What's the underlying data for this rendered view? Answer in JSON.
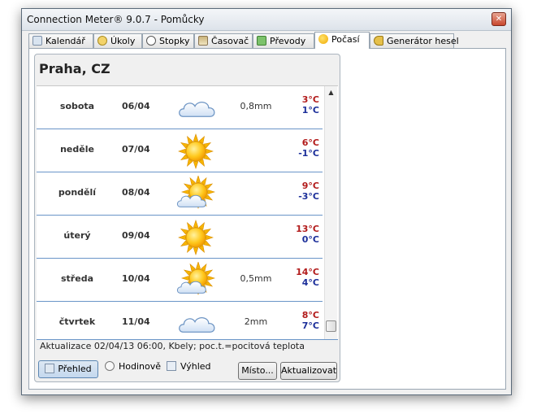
{
  "window": {
    "title": "Connection Meter® 9.0.7 - Pomůcky",
    "close_glyph": "✕"
  },
  "tabs": [
    {
      "label": "Kalendář",
      "icon": "calendar-icon"
    },
    {
      "label": "Úkoly",
      "icon": "tasks-icon"
    },
    {
      "label": "Stopky",
      "icon": "stopwatch-icon"
    },
    {
      "label": "Časovač",
      "icon": "hourglass-icon"
    },
    {
      "label": "Převody",
      "icon": "convert-icon"
    },
    {
      "label": "Počasí",
      "icon": "weather-icon",
      "active": true
    },
    {
      "label": "Generátor hesel",
      "icon": "key-icon"
    }
  ],
  "weather": {
    "location": "Praha, CZ",
    "forecast": [
      {
        "day": "sobota",
        "date": "06/04",
        "condition": "cloudy",
        "precip": "0,8mm",
        "tmax": "3°C",
        "tmin": "1°C"
      },
      {
        "day": "neděle",
        "date": "07/04",
        "condition": "sunny",
        "precip": "",
        "tmax": "6°C",
        "tmin": "-1°C"
      },
      {
        "day": "pondělí",
        "date": "08/04",
        "condition": "partly-cloudy",
        "precip": "",
        "tmax": "9°C",
        "tmin": "-3°C"
      },
      {
        "day": "úterý",
        "date": "09/04",
        "condition": "sunny",
        "precip": "",
        "tmax": "13°C",
        "tmin": "0°C"
      },
      {
        "day": "středa",
        "date": "10/04",
        "condition": "partly-cloudy",
        "precip": "0,5mm",
        "tmax": "14°C",
        "tmin": "4°C"
      },
      {
        "day": "čtvrtek",
        "date": "11/04",
        "condition": "cloudy",
        "precip": "2mm",
        "tmax": "8°C",
        "tmin": "7°C"
      }
    ],
    "update_text": "Aktualizace 02/04/13 06:00, Kbely; poc.t.=pocitová teplota"
  },
  "bottom": {
    "overview_label": "Přehled",
    "hourly_label": "Hodinově",
    "outlook_label": "Výhled",
    "place_button": "Místo...",
    "refresh_button": "Aktualizovat"
  },
  "colors": {
    "tmax": "#b21b1b",
    "tmin": "#1c2f9a",
    "row_divider": "#6a95c8",
    "sun": "#f5b400"
  }
}
